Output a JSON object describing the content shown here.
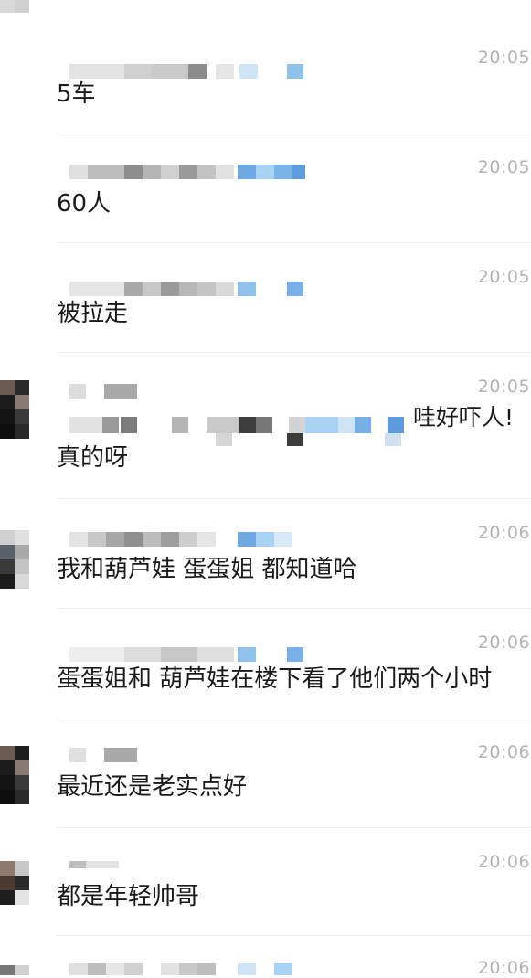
{
  "chat": {
    "messages": [
      {
        "time": "20:05:",
        "text": "5车",
        "avatar": "none"
      },
      {
        "time": "20:05:",
        "text": "60人",
        "avatar": "none"
      },
      {
        "time": "20:05:",
        "text": "被拉走",
        "avatar": "none"
      },
      {
        "time": "20:05:",
        "text": "真的呀",
        "avatar": "dark",
        "quote_tail": "哇好吓人!"
      },
      {
        "time": "20:06:",
        "text": "我和葫芦娃 蛋蛋姐 都知道哈",
        "avatar": "grey"
      },
      {
        "time": "20:06:",
        "text": "蛋蛋姐和 葫芦娃在楼下看了他们两个小时",
        "avatar": "none"
      },
      {
        "time": "20:06:",
        "text": "最近还是老实点好",
        "avatar": "dark"
      },
      {
        "time": "20:06:",
        "text": "都是年轻帅哥",
        "avatar": "brown"
      },
      {
        "time": "20:06:",
        "text": "",
        "avatar": "grey"
      }
    ]
  },
  "colors": {
    "background": "#ffffff",
    "timestamp": "#b3b3b3",
    "message_text": "#1a1a1a",
    "divider": "#ececec",
    "blur_grey": "#9a9a9a",
    "blur_blue": "#7ab3e8"
  }
}
